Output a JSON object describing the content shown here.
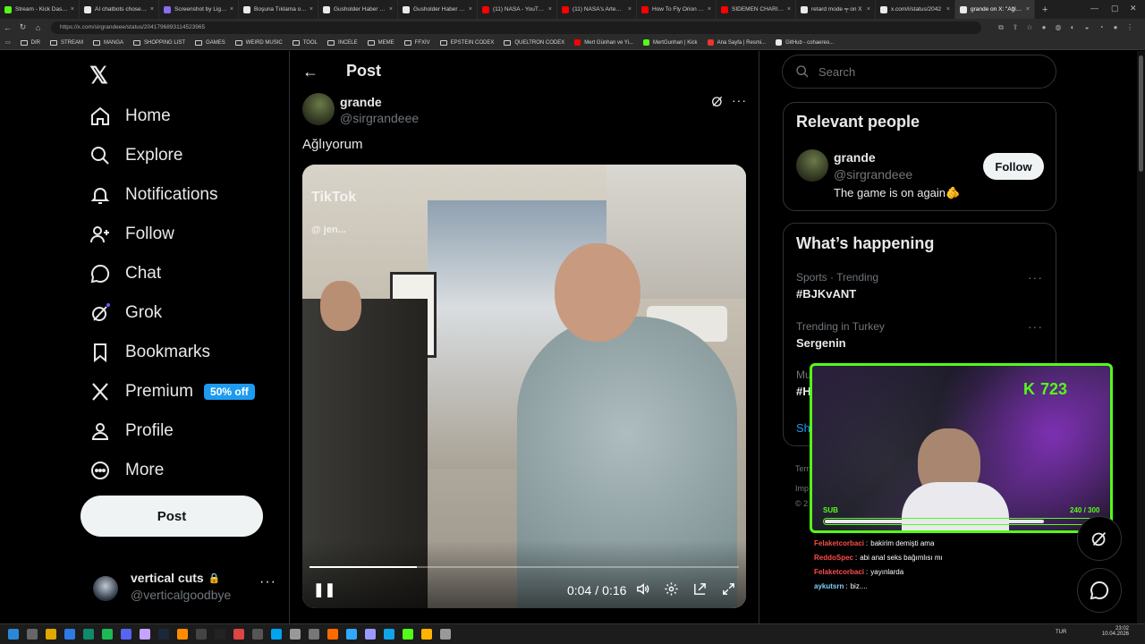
{
  "browser": {
    "tabs": [
      {
        "title": "Stream - Kick Dashboard",
        "color": "#53fc18"
      },
      {
        "title": "AI chatbots chose nuclear",
        "color": "#e7e9ea"
      },
      {
        "title": "Screenshot by Lightshot",
        "color": "#8a6df0"
      },
      {
        "title": "Boşuna Tıklama on X",
        "color": "#e7e9ea"
      },
      {
        "title": "Gusholder Haber Bülteni",
        "color": "#e7e9ea"
      },
      {
        "title": "Gusholder Haber Bülteni",
        "color": "#e7e9ea"
      },
      {
        "title": "(11) NASA - YouTube",
        "color": "#ff0000"
      },
      {
        "title": "(11) NASA's Artemis II",
        "color": "#ff0000"
      },
      {
        "title": "How To Fly Orion - YouTube",
        "color": "#ff0000"
      },
      {
        "title": "SIDEMEN CHARITY MATCH",
        "color": "#ff0000"
      },
      {
        "title": "retard mode ╤ on X",
        "color": "#e7e9ea"
      },
      {
        "title": "x.com/i/status/2042",
        "color": "#e7e9ea"
      },
      {
        "title": "grande on X: \"Ağlıyorum\"",
        "color": "#e7e9ea"
      }
    ],
    "url": "https://x.com/sirgrandeee/status/2041796893114523965",
    "bookmarks": [
      {
        "label": "DIR",
        "kind": "folder"
      },
      {
        "label": "STREAM",
        "kind": "folder"
      },
      {
        "label": "MANGA",
        "kind": "folder"
      },
      {
        "label": "SHOPPING LIST",
        "kind": "folder"
      },
      {
        "label": "GAMES",
        "kind": "folder"
      },
      {
        "label": "WEIRD MUSIC",
        "kind": "folder"
      },
      {
        "label": "TOOL",
        "kind": "folder"
      },
      {
        "label": "INCELE",
        "kind": "folder"
      },
      {
        "label": "MEME",
        "kind": "folder"
      },
      {
        "label": "FFXIV",
        "kind": "folder"
      },
      {
        "label": "EPSTEIN CODEX",
        "kind": "folder"
      },
      {
        "label": "QUELTRON CODEX",
        "kind": "folder"
      },
      {
        "label": "Mert Günhan ve Yi...",
        "kind": "site",
        "color": "#ff0000"
      },
      {
        "label": "MertGunhan | Kick",
        "kind": "site",
        "color": "#53fc18"
      },
      {
        "label": "Ana Sayfa | Resmi...",
        "kind": "site",
        "color": "#e33"
      },
      {
        "label": "GitHub - cohaereo...",
        "kind": "site",
        "color": "#e7e9ea"
      }
    ]
  },
  "nav": {
    "logo": "𝕏",
    "home": "Home",
    "explore": "Explore",
    "notifications": "Notifications",
    "follow": "Follow",
    "chat": "Chat",
    "grok": "Grok",
    "bookmarks": "Bookmarks",
    "premium": "Premium",
    "premium_badge": "50% off",
    "profile": "Profile",
    "more": "More",
    "post_button": "Post",
    "account_name": "vertical cuts",
    "account_handle": "@verticalgoodbye"
  },
  "post": {
    "header": "Post",
    "author_name": "grande",
    "author_handle": "@sirgrandeee",
    "text": "Ağlıyorum",
    "video": {
      "time_current": "0:04",
      "time_total": "0:16",
      "progress": 0.25,
      "time_separator": "/",
      "watermark": "TikTok",
      "watermark_handle": "@ jen..."
    }
  },
  "sidebar": {
    "search_placeholder": "Search",
    "relevant_title": "Relevant people",
    "person_name": "grande",
    "person_handle": "@sirgrandeee",
    "person_bio": "The game is on again🫵",
    "follow_button": "Follow",
    "happening_title": "What’s happening",
    "trends": [
      {
        "meta": "Sports · Trending",
        "name": "#BJKvANT"
      },
      {
        "meta": "Trending in Turkey",
        "name": "Sergenin"
      },
      {
        "meta": "Mu",
        "name": "#H"
      }
    ],
    "show_more": "Sh",
    "footer_fragments": [
      "Terr",
      "Imp",
      "© 2"
    ]
  },
  "stream_overlay": {
    "viewer_count": "723",
    "sub_label": "SUB",
    "sub_progress_text": "240 / 300",
    "sub_progress": 0.8
  },
  "chat": {
    "messages": [
      {
        "user": "Felaketcorbaci",
        "text": "bakirim demişti ama"
      },
      {
        "user": "ReddoSpec",
        "text": "abi anal seks bağımlısı mı"
      },
      {
        "user": "Felaketcorbaci",
        "text": "yayınlarda"
      },
      {
        "user": "aykutsrn",
        "text": "biz...."
      }
    ]
  },
  "taskbar": {
    "lang": "TUR",
    "time": "23:02",
    "date": "10.04.2026"
  }
}
